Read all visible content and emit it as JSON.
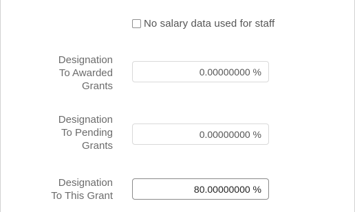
{
  "salary_checkbox": {
    "label": "No salary data used for staff",
    "checked": false
  },
  "fields": [
    {
      "label_lines": [
        "Designation",
        "To Awarded",
        "Grants"
      ],
      "value": "0.00000000 %"
    },
    {
      "label_lines": [
        "Designation",
        "To Pending",
        "Grants"
      ],
      "value": "0.00000000 %"
    },
    {
      "label_lines": [
        "Designation",
        "To This Grant"
      ],
      "value": "80.00000000 %"
    }
  ]
}
